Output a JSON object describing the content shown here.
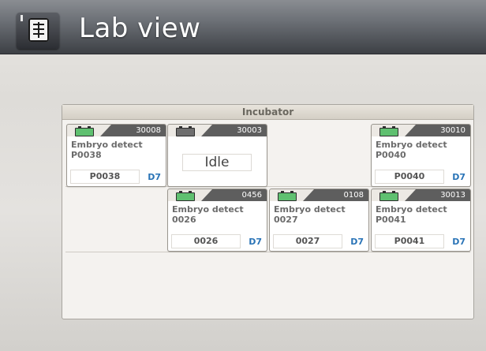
{
  "header": {
    "title": "Lab view",
    "icon": "lab-grid-icon"
  },
  "incubator": {
    "title": "Incubator",
    "slots": [
      {
        "id": "30008",
        "status": "active",
        "line1": "Embryo detect",
        "line2": "P0038",
        "patient": "P0038",
        "day": "D7"
      },
      {
        "id": "30003",
        "status": "idle",
        "idle_label": "Idle"
      },
      {
        "id": "30010",
        "status": "active",
        "line1": "Embryo detect",
        "line2": "P0040",
        "patient": "P0040",
        "day": "D7"
      },
      {
        "id": "0456",
        "status": "active",
        "line1": "Embryo detect",
        "line2": "0026",
        "patient": "0026",
        "day": "D7"
      },
      {
        "id": "0108",
        "status": "active",
        "line1": "Embryo detect",
        "line2": "0027",
        "patient": "0027",
        "day": "D7"
      },
      {
        "id": "30013",
        "status": "active",
        "line1": "Embryo detect",
        "line2": "P0041",
        "patient": "P0041",
        "day": "D7"
      }
    ]
  },
  "colors": {
    "dish_active": "#5fc070",
    "dish_idle": "#6e6e6e",
    "day_text": "#2a74b7"
  }
}
